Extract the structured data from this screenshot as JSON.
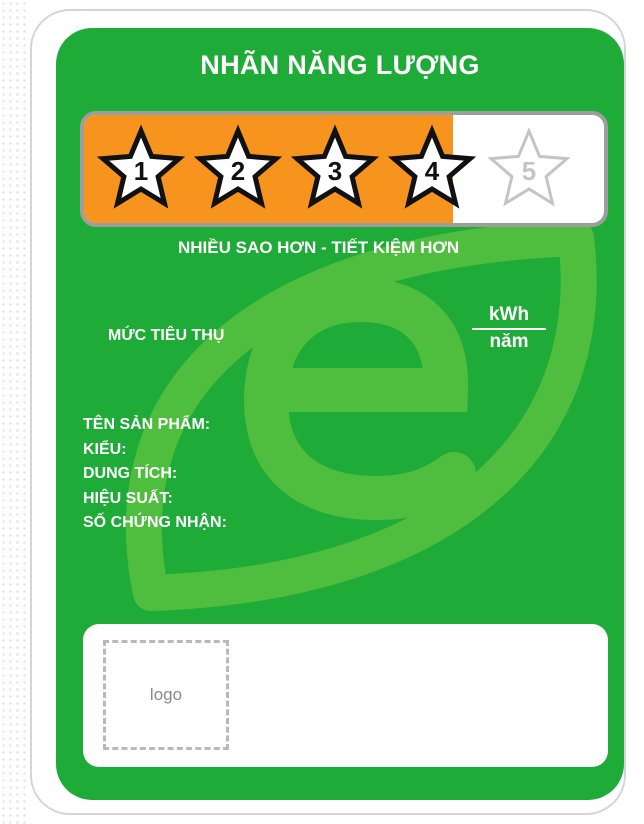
{
  "label": {
    "title": "NHÃN NĂNG LƯỢNG",
    "rating": {
      "stars_total": 5,
      "stars_achieved": 4,
      "fill_fraction": 0.71,
      "star_numbers": [
        "1",
        "2",
        "3",
        "4",
        "5"
      ]
    },
    "slogan": "NHIỀU SAO HƠN - TIẾT KIỆM HƠN",
    "consumption_label": "MỨC TIÊU THỤ",
    "unit_numerator": "kWh",
    "unit_denominator": "năm",
    "fields": [
      "TÊN SẢN PHẨM:",
      "KIỂU:",
      "DUNG TÍCH:",
      "HIỆU SUẤT:",
      "SỐ CHỨNG NHẬN:"
    ],
    "logo_placeholder": "logo"
  },
  "colors": {
    "label_green": "#1eab37",
    "watermark_green": "#4fbe3e",
    "star_orange": "#f7941d",
    "frame_gray": "#9d9d9d"
  },
  "icons": {
    "star": "star-outline-icon",
    "watermark": "energy-leaf-e-icon"
  }
}
